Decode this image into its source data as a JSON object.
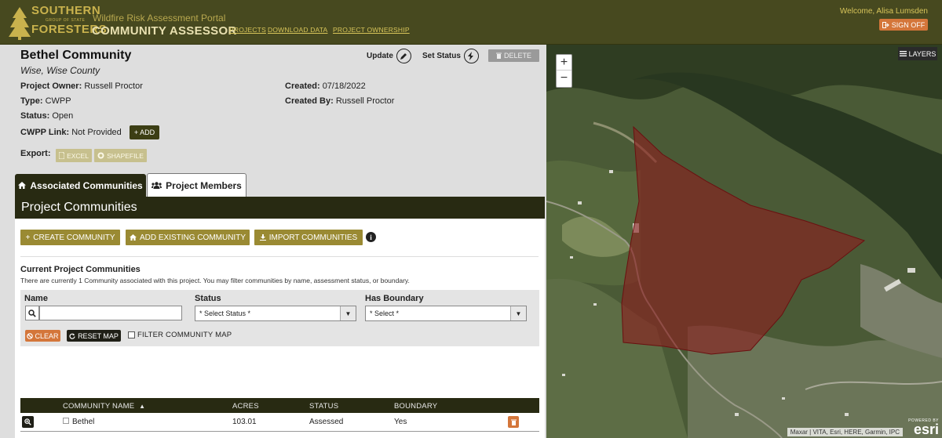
{
  "header": {
    "logo": {
      "line1": "SOUTHERN",
      "line2": "GROUP OF STATE",
      "line3": "FORESTERS"
    },
    "portal_subtitle": "Wildfire Risk Assessment Portal",
    "portal_title": "COMMUNITY ASSESSOR",
    "nav": [
      "PROJECTS",
      "DOWNLOAD DATA",
      "PROJECT OWNERSHIP"
    ],
    "welcome": "Welcome, Alisa Lumsden",
    "signoff": "SIGN OFF"
  },
  "project": {
    "title": "Bethel Community",
    "location": "Wise, Wise County",
    "owner_label": "Project Owner:",
    "owner": "Russell Proctor",
    "type_label": "Type:",
    "type": "CWPP",
    "status_label": "Status:",
    "status": "Open",
    "cwpp_label": "CWPP Link:",
    "cwpp": "Not Provided",
    "created_label": "Created:",
    "created": "07/18/2022",
    "created_by_label": "Created By:",
    "created_by": "Russell Proctor",
    "export_label": "Export:",
    "excel": "EXCEL",
    "shapefile": "SHAPEFILE",
    "add": "ADD",
    "update": "Update",
    "set_status": "Set Status",
    "delete": "DELETE"
  },
  "tabs": {
    "associated": "Associated Communities",
    "members": "Project Members"
  },
  "section": {
    "title": "Project Communities",
    "create": "CREATE COMMUNITY",
    "add_existing": "ADD EXISTING COMMUNITY",
    "import": "IMPORT COMMUNITIES",
    "info_glyph": "i",
    "current_title": "Current Project Communities",
    "current_desc": "There are currently 1 Community associated with this project. You may filter communities by name, assessment status, or boundary."
  },
  "filters": {
    "name_label": "Name",
    "name_value": "",
    "status_label": "Status",
    "status_value": "* Select Status *",
    "boundary_label": "Has Boundary",
    "boundary_value": "* Select *",
    "clear": "CLEAR",
    "reset_map": "RESET MAP",
    "filter_map": "FILTER COMMUNITY MAP"
  },
  "table": {
    "headers": {
      "name": "COMMUNITY NAME",
      "acres": "ACRES",
      "status": "STATUS",
      "boundary": "BOUNDARY"
    },
    "sort_glyph": "▲",
    "rows": [
      {
        "name": "Bethel",
        "acres": "103.01",
        "status": "Assessed",
        "boundary": "Yes"
      }
    ]
  },
  "map": {
    "layers": "LAYERS",
    "zoom_in": "+",
    "zoom_out": "−",
    "attribution": "Maxar | VITA, Esri, HERE, Garmin, IPC",
    "esri_powered": "POWERED BY",
    "esri": "esri"
  },
  "colors": {
    "header_bg": "#47491f",
    "accent_orange": "#d4763a",
    "olive_button": "#9a8a33",
    "polygon": "#8b1e1e"
  }
}
